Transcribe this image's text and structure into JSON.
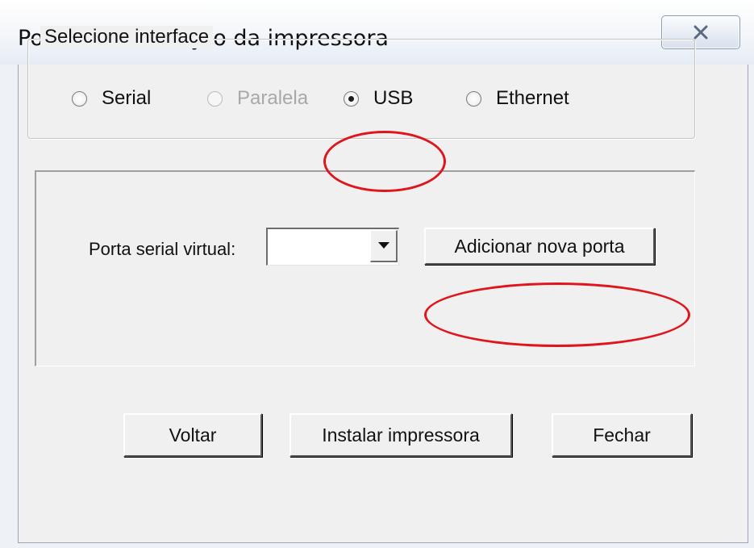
{
  "window": {
    "title": "Porta de instalação da impressora",
    "close_icon": "close-icon"
  },
  "interface_group": {
    "label": "Selecione interface",
    "options": [
      {
        "label": "Serial",
        "selected": false,
        "enabled": true
      },
      {
        "label": "Paralela",
        "selected": false,
        "enabled": false
      },
      {
        "label": "USB",
        "selected": true,
        "enabled": true
      },
      {
        "label": "Ethernet",
        "selected": false,
        "enabled": true
      }
    ]
  },
  "port_panel": {
    "field_label": "Porta serial virtual:",
    "combo_value": "",
    "combo_arrow_icon": "chevron-down-icon",
    "add_button_label": "Adicionar nova porta"
  },
  "footer": {
    "back_label": "Voltar",
    "install_label": "Instalar impressora",
    "close_label": "Fechar"
  },
  "colors": {
    "annotation": "#e0151c",
    "dialog_bg": "#f0f0f0"
  }
}
